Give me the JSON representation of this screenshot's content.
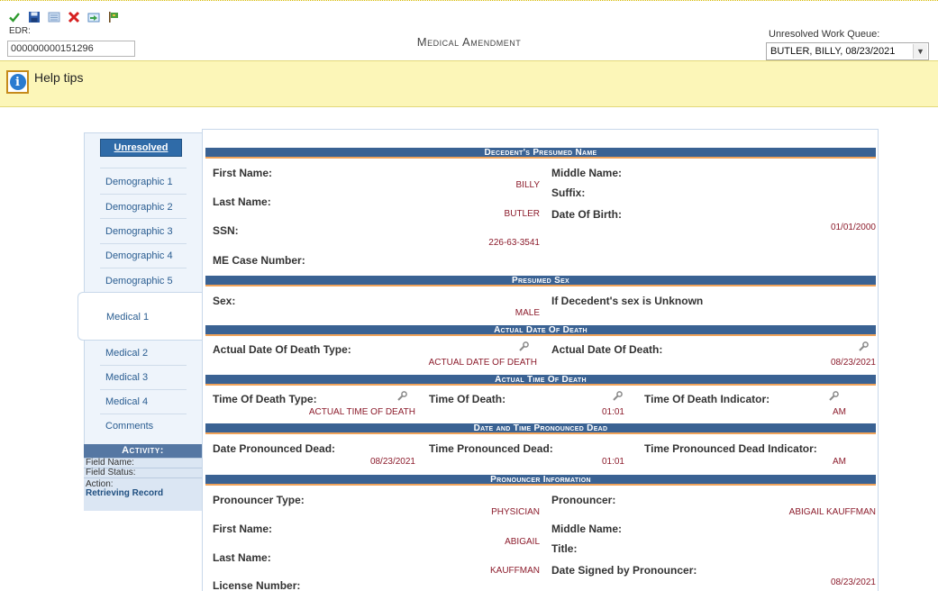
{
  "edr": {
    "label": "EDR:",
    "value": "000000000151296"
  },
  "page_title": "Medical Amendment",
  "work_queue": {
    "label": "Unresolved Work Queue:",
    "selected": "BUTLER, BILLY, 08/23/2021"
  },
  "help": {
    "text": "Help tips"
  },
  "nav": {
    "unresolved": "Unresolved",
    "items": [
      "Demographic 1",
      "Demographic 2",
      "Demographic 3",
      "Demographic 4",
      "Demographic 5"
    ],
    "active": "Medical 1",
    "items_after": [
      "Medical 2",
      "Medical 3",
      "Medical 4",
      "Comments"
    ]
  },
  "activity": {
    "title": "Activity:",
    "field_name": "Field Name:",
    "field_status": "Field Status:",
    "action_label": "Action:",
    "action_value": "Retrieving Record"
  },
  "sections": {
    "name": {
      "title": "Decedent's Presumed Name",
      "first_name_label": "First Name:",
      "first_name": "BILLY",
      "last_name_label": "Last Name:",
      "last_name": "BUTLER",
      "ssn_label": "SSN:",
      "ssn": "226-63-3541",
      "me_case_label": "ME Case Number:",
      "middle_name_label": "Middle Name:",
      "suffix_label": "Suffix:",
      "dob_label": "Date Of Birth:",
      "dob": "01/01/2000"
    },
    "sex": {
      "title": "Presumed Sex",
      "sex_label": "Sex:",
      "sex": "MALE",
      "unknown_label": "If Decedent's sex is Unknown"
    },
    "actual_date": {
      "title": "Actual Date Of Death",
      "type_label": "Actual Date Of Death Type:",
      "type": "ACTUAL DATE OF DEATH",
      "date_label": "Actual Date Of Death:",
      "date": "08/23/2021"
    },
    "actual_time": {
      "title": "Actual Time Of Death",
      "type_label": "Time Of Death Type:",
      "type": "ACTUAL TIME OF DEATH",
      "time_label": "Time Of Death:",
      "time": "01:01",
      "indicator_label": "Time Of Death Indicator:",
      "indicator": "AM"
    },
    "pronounced": {
      "title": "Date and Time Pronounced Dead",
      "date_label": "Date Pronounced Dead:",
      "date": "08/23/2021",
      "time_label": "Time Pronounced Dead:",
      "time": "01:01",
      "indicator_label": "Time Pronounced Dead Indicator:",
      "indicator": "AM"
    },
    "pronouncer": {
      "title": "Pronouncer Information",
      "type_label": "Pronouncer Type:",
      "type": "PHYSICIAN",
      "first_name_label": "First Name:",
      "first_name": "ABIGAIL",
      "last_name_label": "Last Name:",
      "last_name": "KAUFFMAN",
      "license_label": "License Number:",
      "pronouncer_label": "Pronouncer:",
      "pronouncer": "ABIGAIL KAUFFMAN",
      "middle_name_label": "Middle Name:",
      "title_label": "Title:",
      "date_signed_label": "Date Signed by Pronouncer:",
      "date_signed": "08/23/2021"
    }
  },
  "colors": {
    "section_header": "#3a6293",
    "section_underline": "#f0a35a",
    "value_text": "#8c1c2c",
    "help_bg": "#fcf6b8"
  }
}
